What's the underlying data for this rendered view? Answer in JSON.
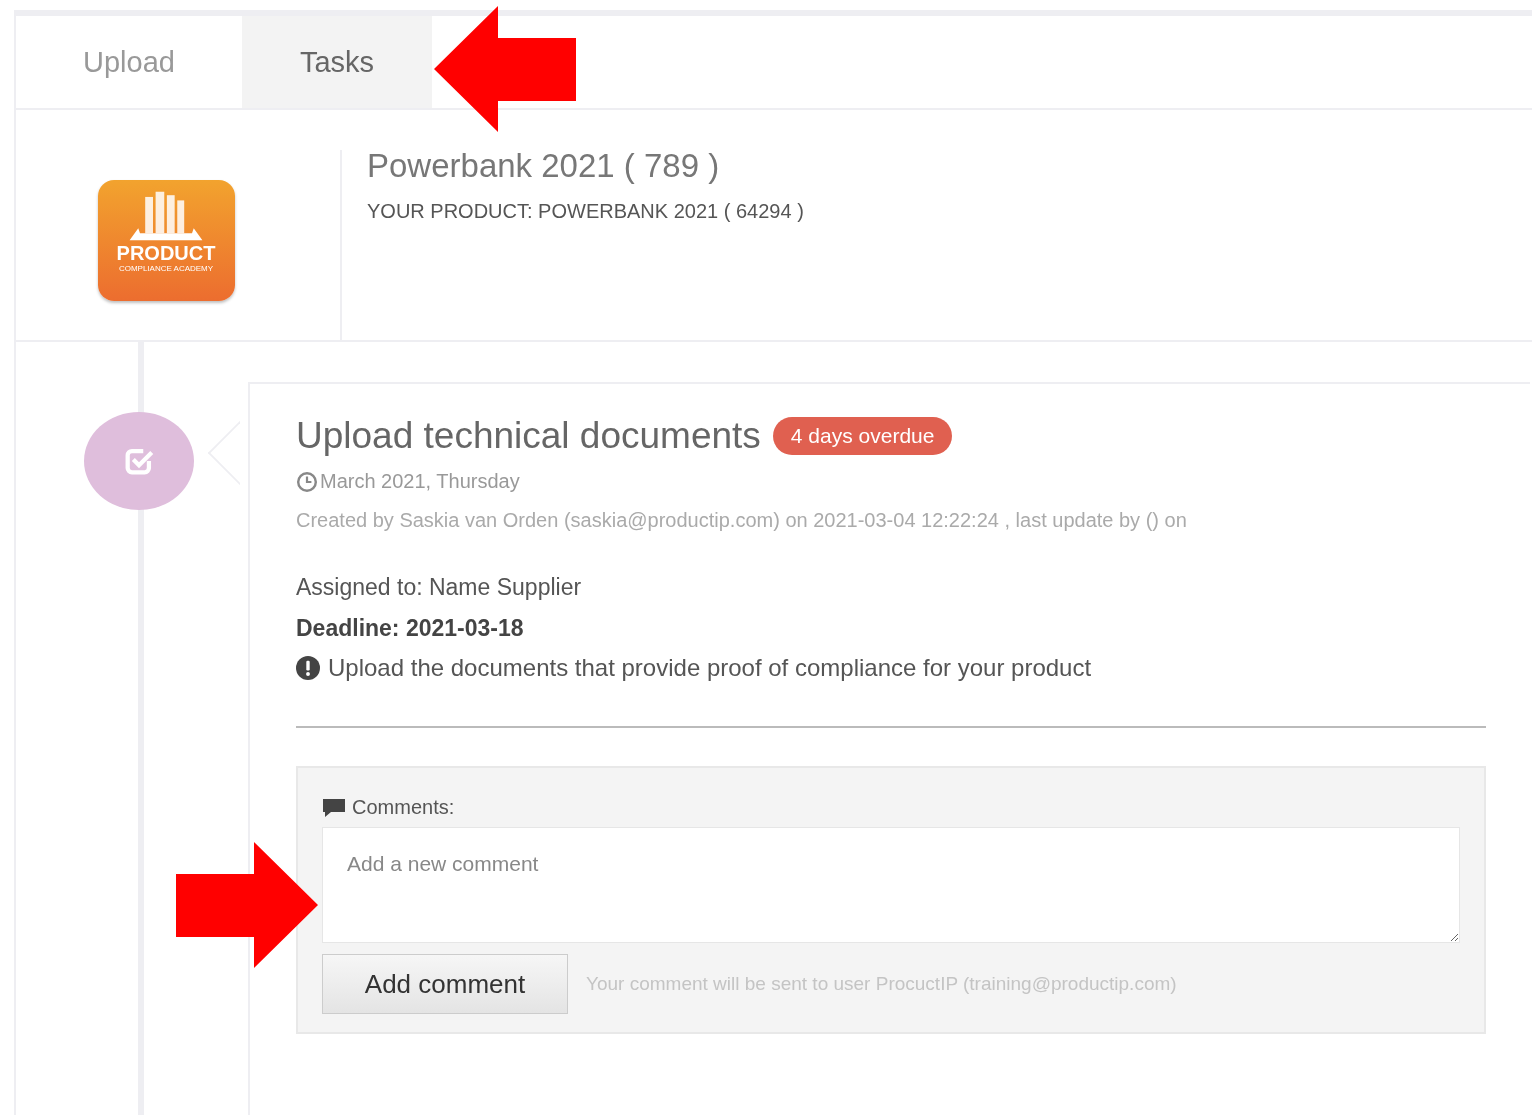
{
  "tabs": [
    {
      "label": "Upload",
      "selected": false
    },
    {
      "label": "Tasks",
      "selected": true
    }
  ],
  "product": {
    "logo": {
      "word": "PRODUCT",
      "tagline": "COMPLIANCE ACADEMY"
    },
    "title": "Powerbank 2021 ( 789 )",
    "subtitle": "YOUR PRODUCT: POWERBANK 2021 ( 64294 )"
  },
  "task": {
    "title": "Upload technical documents",
    "badge": "4 days overdue",
    "date": "March 2021, Thursday",
    "created": "Created by Saskia van Orden (saskia@productip.com) on 2021-03-04 12:22:24 , last update by () on",
    "assigned": "Assigned to: Name Supplier",
    "deadline": "Deadline: 2021-03-18",
    "note": "Upload the documents that provide proof of compliance for your product"
  },
  "comments": {
    "label": "Comments:",
    "placeholder": "Add a new comment",
    "button": "Add comment",
    "hint": "Your comment will be sent to user ProcuctIP (training@productip.com)"
  }
}
